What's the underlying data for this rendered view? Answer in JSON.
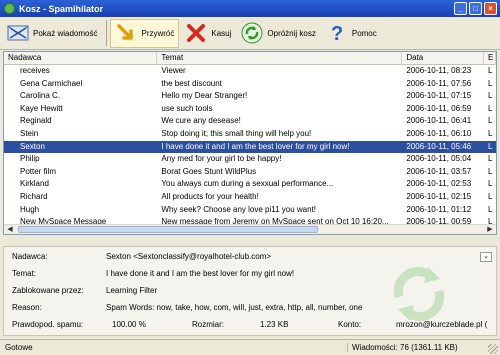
{
  "window": {
    "title": "Kosz - Spamihilator"
  },
  "toolbar": {
    "show_label": "Pokaż wiadomość",
    "restore_label": "Przywróć",
    "delete_label": "Kasuj",
    "empty_label": "Opróżnij kosz",
    "help_label": "Pomoc"
  },
  "list": {
    "headers": {
      "sender": "Nadawca",
      "subject": "Temat",
      "date": "Data",
      "extra": "E"
    },
    "rows": [
      {
        "sender": "receives",
        "subject": "Viewer",
        "date": "2006-10-11, 08:23",
        "extra": "L"
      },
      {
        "sender": "Gena Carmichael",
        "subject": "the best discount",
        "date": "2006-10-11, 07:56",
        "extra": "L"
      },
      {
        "sender": "Carolina C.",
        "subject": "Hello my Dear Stranger!",
        "date": "2006-10-11, 07:15",
        "extra": "L"
      },
      {
        "sender": "Kaye Hewitt",
        "subject": "use such tools",
        "date": "2006-10-11, 06:59",
        "extra": "L"
      },
      {
        "sender": "Reginald",
        "subject": "We cure any desease!",
        "date": "2006-10-11, 06:41",
        "extra": "L"
      },
      {
        "sender": "Stein",
        "subject": "Stop doing it; this small thing will help you!",
        "date": "2006-10-11, 06:10",
        "extra": "L"
      },
      {
        "sender": "Sexton",
        "subject": "I have done it and I am the best lover for my girl now!",
        "date": "2006-10-11, 05:46",
        "extra": "L"
      },
      {
        "sender": "Philip",
        "subject": "Any med for your girl to be happy!",
        "date": "2006-10-11, 05:04",
        "extra": "L"
      },
      {
        "sender": "Potter film",
        "subject": "Borat Goes Stunt WildPlus",
        "date": "2006-10-11, 03:57",
        "extra": "L"
      },
      {
        "sender": "Kirkland",
        "subject": "You always cum during a sexxual performance...",
        "date": "2006-10-11, 02:53",
        "extra": "L"
      },
      {
        "sender": "Richard",
        "subject": "All products for your health!",
        "date": "2006-10-11, 02:15",
        "extra": "L"
      },
      {
        "sender": "Hugh",
        "subject": "Why seek? Choose any love pi11 you want!",
        "date": "2006-10-11, 01:12",
        "extra": "L"
      },
      {
        "sender": "New MySpace Message",
        "subject": "New message from Jeremy on MySpace sent on Oct 10 16:20...",
        "date": "2006-10-11, 00:59",
        "extra": "L"
      }
    ]
  },
  "details": {
    "sender_label": "Nadawca:",
    "sender_value": "Sexton <Sextonclassify@royalhotel-club.com>",
    "subject_label": "Temat:",
    "subject_value": "I have done it and I am the best lover for my girl now!",
    "blocked_label": "Zablokowane przez:",
    "blocked_value": "Learning Filter",
    "reason_label": "Reason:",
    "reason_value": "Spam Words: now, take, how, com, will, just, extra, http, all, number, one",
    "prob_label": "Prawdopod. spamu:",
    "prob_value": "100.00 %",
    "size_label": "Rozmiar:",
    "size_value": "1.23 KB",
    "account_label": "Konto:",
    "account_value": "mrozon@kurczeblade.pl ("
  },
  "status": {
    "left": "Gotowe",
    "right": "Wiadomości: 76 (1361.11 KB)"
  },
  "colors": {
    "selection": "#2c4f9e",
    "titlebar": "#2b63d6"
  },
  "icons": [
    "app-icon",
    "envelope-icon",
    "restore-arrow-icon",
    "delete-x-icon",
    "recycle-icon",
    "help-question-icon",
    "expand-icon"
  ]
}
